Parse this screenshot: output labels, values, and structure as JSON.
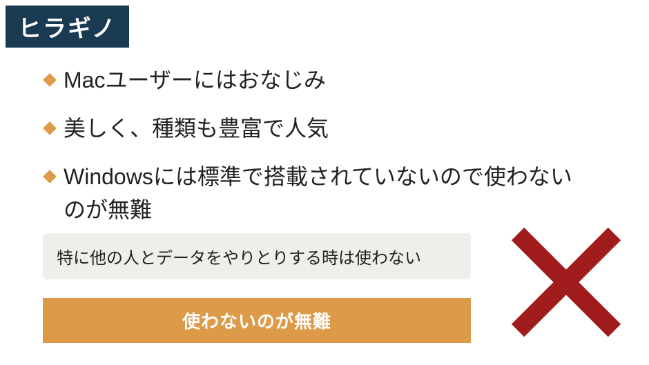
{
  "title": "ヒラギノ",
  "bullets": [
    "Macユーザーにはおなじみ",
    "美しく、種類も豊富で人気",
    "Windowsには標準で搭載されていないので使わないのが無難"
  ],
  "note": "特に他の人とデータをやりとりする時は使わない",
  "banner": "使わないのが無難",
  "colors": {
    "title_bg": "#1a3a52",
    "diamond": "#dd9a49",
    "note_bg": "#efeeea",
    "banner_bg": "#dd9a49",
    "cross": "#a01c1c"
  }
}
